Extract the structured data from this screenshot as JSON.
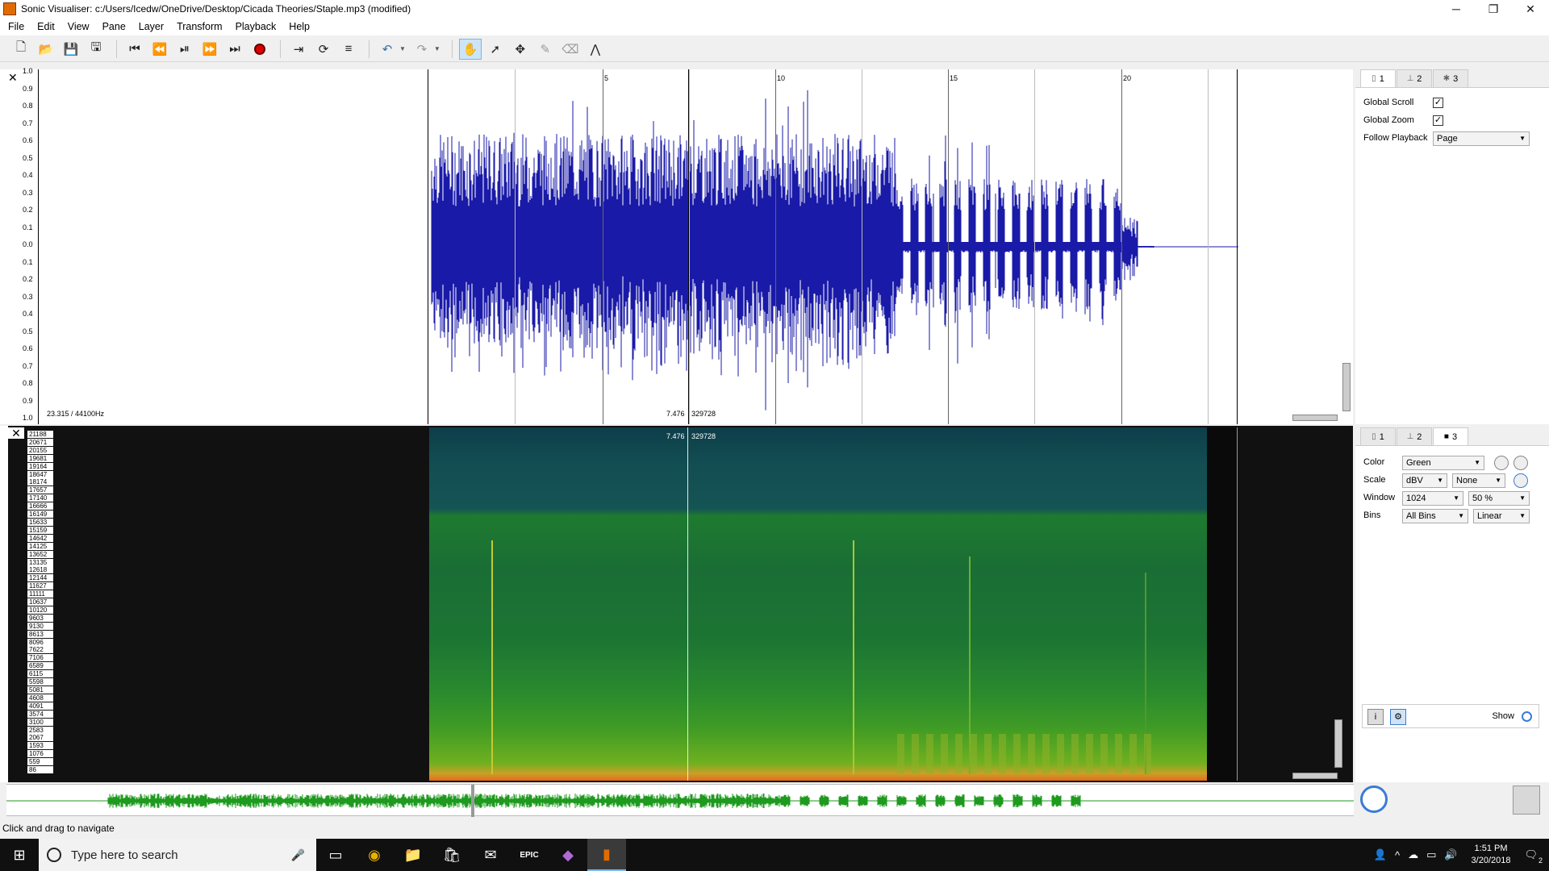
{
  "window": {
    "title": "Sonic Visualiser: c:/Users/Icedw/OneDrive/Desktop/Cicada Theories/Staple.mp3 (modified)",
    "minimize": "─",
    "restore": "❐",
    "close": "✕"
  },
  "menu": [
    "File",
    "Edit",
    "View",
    "Pane",
    "Layer",
    "Transform",
    "Playback",
    "Help"
  ],
  "toolbar": {
    "icons": [
      "new-icon",
      "open-icon",
      "save-icon",
      "save-session-icon",
      "rewind-start-icon",
      "rewind-icon",
      "play-pause-icon",
      "fast-forward-icon",
      "fast-forward-end-icon",
      "record-icon",
      "constrain-icon",
      "loop-icon",
      "solo-icon",
      "undo-icon",
      "redo-icon",
      "navigate-icon",
      "select-icon",
      "move-icon",
      "draw-icon",
      "erase-icon",
      "measure-icon"
    ]
  },
  "pane1": {
    "close": "✕",
    "scale_ticks": [
      "1.0",
      "0.9",
      "0.8",
      "0.7",
      "0.6",
      "0.5",
      "0.4",
      "0.3",
      "0.2",
      "0.1",
      "0.0",
      "0.1",
      "0.2",
      "0.3",
      "0.4",
      "0.5",
      "0.6",
      "0.7",
      "0.8",
      "0.9",
      "1.0"
    ],
    "time_labels": [
      "5",
      "10",
      "15",
      "20"
    ],
    "sample_rate_label": "23.315 / 44100Hz",
    "playhead_time": "7.476",
    "playhead_frame": "329728",
    "wave_color": "#1a1aa8"
  },
  "pane2": {
    "close": "✕",
    "freq_ticks": [
      "21188",
      "20671",
      "20155",
      "19681",
      "19164",
      "18647",
      "18174",
      "17657",
      "17140",
      "16666",
      "16149",
      "15633",
      "15159",
      "14642",
      "14125",
      "13652",
      "13135",
      "12618",
      "12144",
      "11627",
      "11111",
      "10637",
      "10120",
      "9603",
      "9130",
      "8613",
      "8096",
      "7622",
      "7106",
      "6589",
      "6115",
      "5598",
      "5081",
      "4608",
      "4091",
      "3574",
      "3100",
      "2583",
      "2067",
      "1593",
      "1076",
      "559",
      "86"
    ],
    "playhead_time": "7.476",
    "playhead_frame": "329728"
  },
  "layer_panel_top": {
    "tabs": [
      "1",
      "2",
      "3"
    ],
    "global_scroll_label": "Global Scroll",
    "global_scroll_checked": "✓",
    "global_zoom_label": "Global Zoom",
    "global_zoom_checked": "✓",
    "follow_playback_label": "Follow Playback",
    "follow_playback_value": "Page"
  },
  "layer_panel_bottom": {
    "tabs": [
      "1",
      "2",
      "3"
    ],
    "color_label": "Color",
    "color_value": "Green",
    "scale_label": "Scale",
    "scale_value": "dBV",
    "scale_norm_value": "None",
    "window_label": "Window",
    "window_value": "1024",
    "window_overlap_value": "50 %",
    "bins_label": "Bins",
    "bins_value": "All Bins",
    "bins_scale_value": "Linear",
    "show_label": "Show"
  },
  "status": "Click and drag to navigate",
  "taskbar": {
    "search_placeholder": "Type here to search",
    "time": "1:51 PM",
    "date": "3/20/2018",
    "notification_count": "2"
  },
  "colors": {
    "waveform": "#1a1aa8",
    "overview": "#1e9a1e",
    "spectrogram_top": "#0e3e4a",
    "spectrogram_mid": "#1e7a2f",
    "spectrogram_bottom": "#e66a1a"
  }
}
